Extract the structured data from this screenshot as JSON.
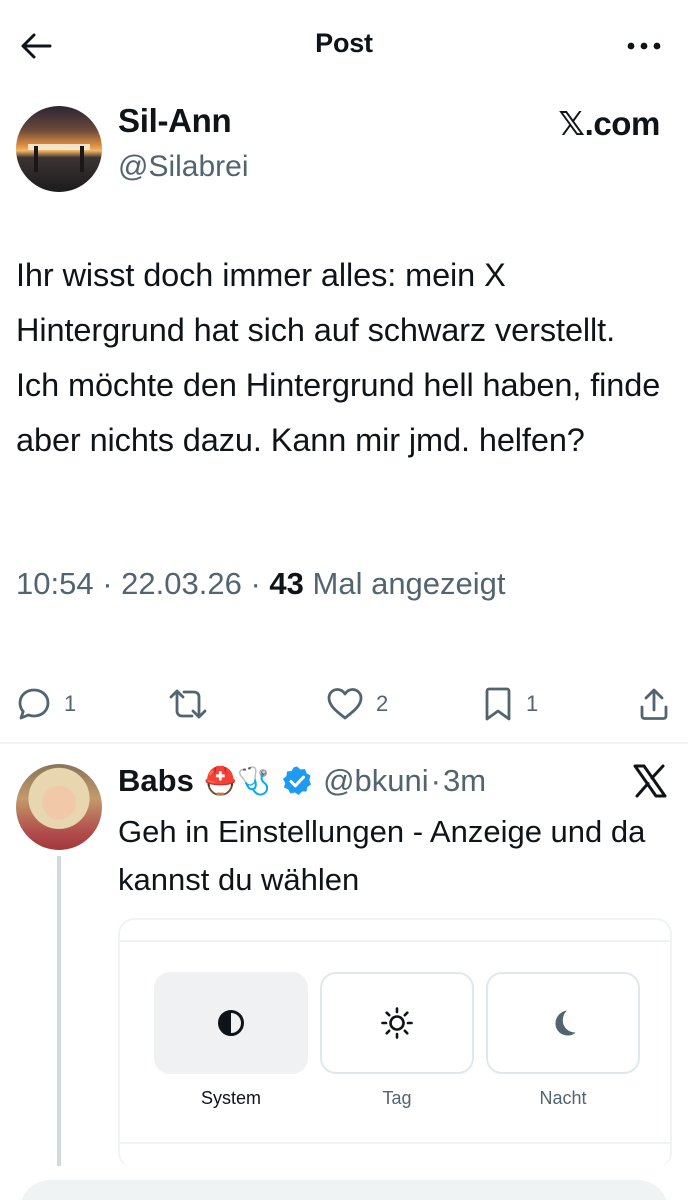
{
  "header": {
    "back_icon": "arrow-left-icon",
    "title": "Post",
    "more_icon": "more-horizontal-icon"
  },
  "post": {
    "author_name": "Sil-Ann",
    "author_handle": "@Silabrei",
    "source_label": "𝕏.com",
    "text": "Ihr wisst doch immer alles: mein X Hintergrund hat sich auf schwarz verstellt. Ich möchte den Hintergrund hell haben, finde aber nichts dazu. Kann mir jmd. helfen?",
    "time": "10:54",
    "date": "22.03.26",
    "views_count": "43",
    "views_label": "Mal angezeigt",
    "meta_separator": "·"
  },
  "actions": {
    "reply_count": "1",
    "repost_count": "",
    "like_count": "2",
    "bookmark_count": "1"
  },
  "reply": {
    "author_name": "Babs",
    "emoji": "⛑️🩺",
    "verified": true,
    "handle": "@bkuni",
    "separator": "·",
    "time": "3m",
    "text": "Geh in Einstellungen - Anzeige und da kannst du wählen",
    "embed": {
      "options": [
        {
          "label": "System",
          "icon": "contrast-half-icon",
          "selected": true
        },
        {
          "label": "Tag",
          "icon": "sun-icon",
          "selected": false
        },
        {
          "label": "Nacht",
          "icon": "moon-icon",
          "selected": false
        }
      ]
    }
  },
  "colors": {
    "text": "#0f1419",
    "secondary": "#536471",
    "verified_blue": "#1d9bf0",
    "divider": "#eff3f4"
  }
}
